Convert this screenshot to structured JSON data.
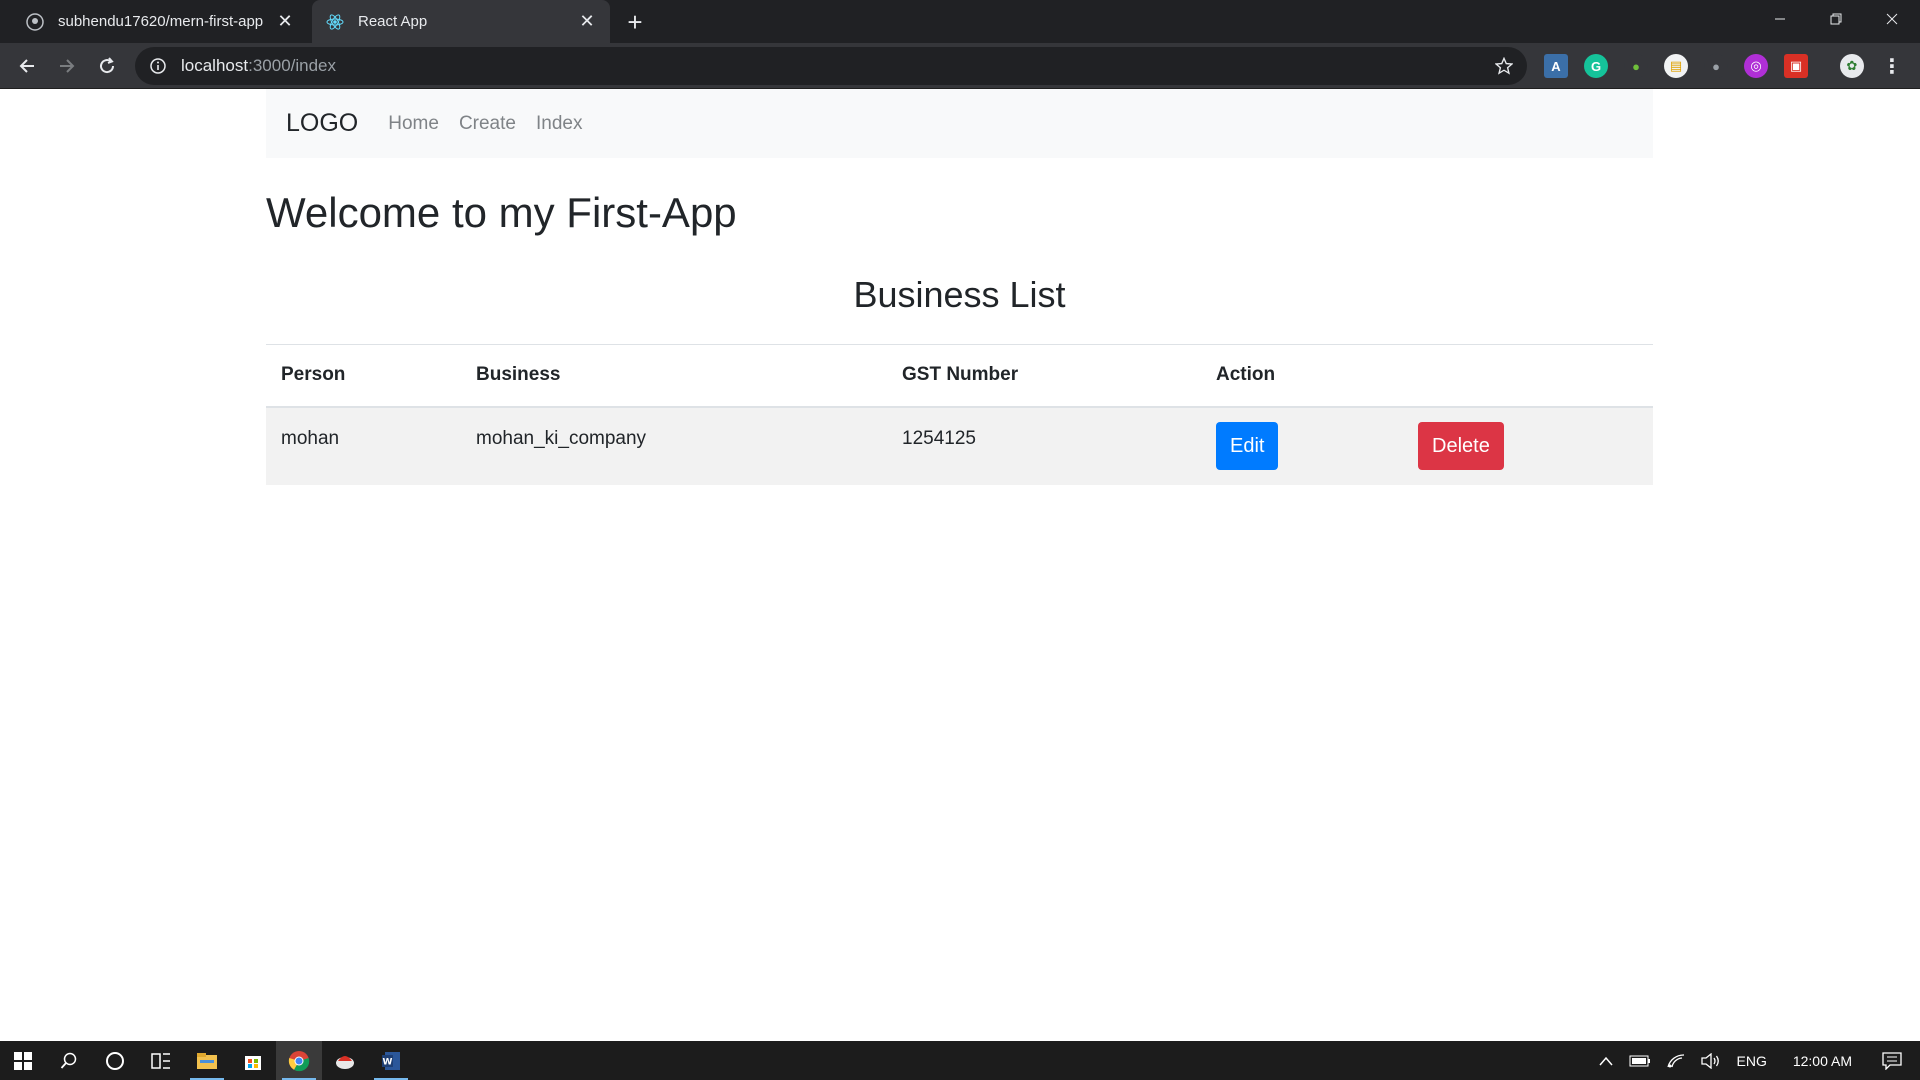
{
  "browser": {
    "tabs": [
      {
        "title": "subhendu17620/mern-first-app",
        "icon": "github-icon",
        "active": false
      },
      {
        "title": "React App",
        "icon": "react-icon",
        "active": true
      }
    ],
    "new_tab_label": "+",
    "url_host": "localhost",
    "url_path": ":3000/index"
  },
  "navbar": {
    "brand": "LOGO",
    "links": [
      "Home",
      "Create",
      "Index"
    ]
  },
  "page": {
    "heading": "Welcome to my First-App",
    "list_title": "Business List"
  },
  "table": {
    "headers": [
      "Person",
      "Business",
      "GST Number",
      "Action"
    ],
    "rows": [
      {
        "person": "mohan",
        "business": "mohan_ki_company",
        "gst": "1254125",
        "edit_label": "Edit",
        "delete_label": "Delete"
      }
    ]
  },
  "taskbar": {
    "language": "ENG",
    "time": "12:00 AM"
  },
  "colors": {
    "edit": "#007bff",
    "delete": "#dc3545",
    "navbar_bg": "#f8f9fa",
    "chrome_dark": "#202124"
  }
}
